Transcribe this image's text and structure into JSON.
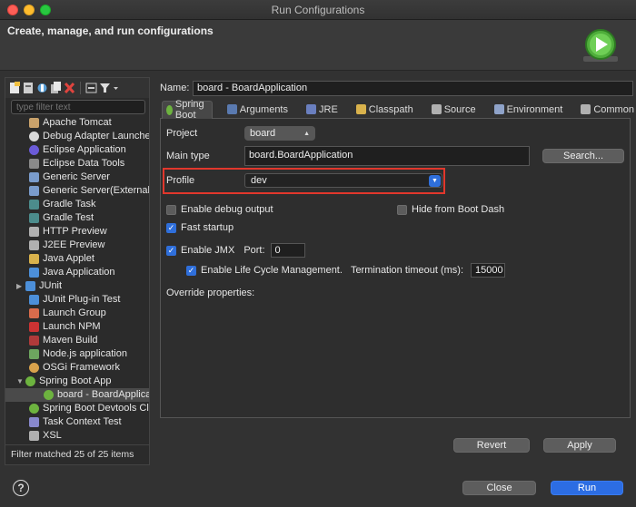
{
  "window": {
    "title": "Run Configurations"
  },
  "header": {
    "title": "Create, manage, and run configurations"
  },
  "sidebar": {
    "filter_placeholder": "type filter text",
    "items": [
      {
        "label": "Apache Tomcat",
        "icon": "tomcat-icon",
        "color": "#c9a26b"
      },
      {
        "label": "Debug Adapter Launcher",
        "icon": "debug-adapter-icon",
        "color": "#d9d9d9"
      },
      {
        "label": "Eclipse Application",
        "icon": "eclipse-icon",
        "color": "#6b5bd8"
      },
      {
        "label": "Eclipse Data Tools",
        "icon": "data-tools-icon",
        "color": "#8a8a8a"
      },
      {
        "label": "Generic Server",
        "icon": "server-icon",
        "color": "#7a9ccc"
      },
      {
        "label": "Generic Server(External La",
        "icon": "server-external-icon",
        "color": "#7a9ccc"
      },
      {
        "label": "Gradle Task",
        "icon": "gradle-icon",
        "color": "#4c8c8c"
      },
      {
        "label": "Gradle Test",
        "icon": "gradle-test-icon",
        "color": "#4c8c8c"
      },
      {
        "label": "HTTP Preview",
        "icon": "http-preview-icon",
        "color": "#b0b0b0"
      },
      {
        "label": "J2EE Preview",
        "icon": "j2ee-preview-icon",
        "color": "#b0b0b0"
      },
      {
        "label": "Java Applet",
        "icon": "java-applet-icon",
        "color": "#d9b24c"
      },
      {
        "label": "Java Application",
        "icon": "java-app-icon",
        "color": "#4c8fd9"
      },
      {
        "label": "JUnit",
        "icon": "junit-icon",
        "color": "#4c8fd9"
      },
      {
        "label": "JUnit Plug-in Test",
        "icon": "junit-plugin-icon",
        "color": "#4c8fd9"
      },
      {
        "label": "Launch Group",
        "icon": "launch-group-icon",
        "color": "#d96c4c"
      },
      {
        "label": "Launch NPM",
        "icon": "npm-icon",
        "color": "#cc3333"
      },
      {
        "label": "Maven Build",
        "icon": "maven-icon",
        "color": "#b03a3a"
      },
      {
        "label": "Node.js application",
        "icon": "nodejs-icon",
        "color": "#6da55f"
      },
      {
        "label": "OSGi Framework",
        "icon": "osgi-icon",
        "color": "#d9a24c"
      },
      {
        "label": "Spring Boot App",
        "icon": "spring-boot-icon",
        "color": "#6db33f"
      },
      {
        "label": "board - BoardApplicati",
        "icon": "spring-app-icon",
        "color": "#6db33f"
      },
      {
        "label": "Spring Boot Devtools Clien",
        "icon": "spring-devtools-icon",
        "color": "#6db33f"
      },
      {
        "label": "Task Context Test",
        "icon": "task-context-icon",
        "color": "#8888cc"
      },
      {
        "label": "XSL",
        "icon": "xsl-icon",
        "color": "#b0b0b0"
      }
    ],
    "footer": "Filter matched 25 of 25 items"
  },
  "config": {
    "name_label": "Name:",
    "name_value": "board - BoardApplication",
    "tabs": [
      {
        "label": "Spring Boot",
        "icon": "spring-boot-icon",
        "color": "#6db33f"
      },
      {
        "label": "Arguments",
        "icon": "arguments-icon",
        "color": "#5a7ab0"
      },
      {
        "label": "JRE",
        "icon": "jre-icon",
        "color": "#6a7fbf"
      },
      {
        "label": "Classpath",
        "icon": "classpath-icon",
        "color": "#d9b24c"
      },
      {
        "label": "Source",
        "icon": "source-icon",
        "color": "#b0b0b0"
      },
      {
        "label": "Environment",
        "icon": "environment-icon",
        "color": "#8fa3c9"
      },
      {
        "label": "Common",
        "icon": "common-icon",
        "color": "#b0b0b0"
      }
    ],
    "project_label": "Project",
    "project_value": "board",
    "main_type_label": "Main type",
    "main_type_value": "board.BoardApplication",
    "search_label": "Search...",
    "profile_label": "Profile",
    "profile_value": "dev",
    "enable_debug_label": "Enable debug output",
    "hide_boot_dash_label": "Hide from Boot Dash",
    "fast_startup_label": "Fast startup",
    "enable_jmx_label": "Enable JMX",
    "port_label": "Port:",
    "port_value": "0",
    "lifecycle_label": "Enable Life Cycle Management.",
    "timeout_label": "Termination timeout (ms):",
    "timeout_value": "15000",
    "override_label": "Override properties:"
  },
  "buttons": {
    "revert": "Revert",
    "apply": "Apply",
    "close": "Close",
    "run": "Run",
    "help": "?"
  },
  "colors": {
    "accent": "#2c6de3",
    "highlight_border": "#e2372c"
  }
}
